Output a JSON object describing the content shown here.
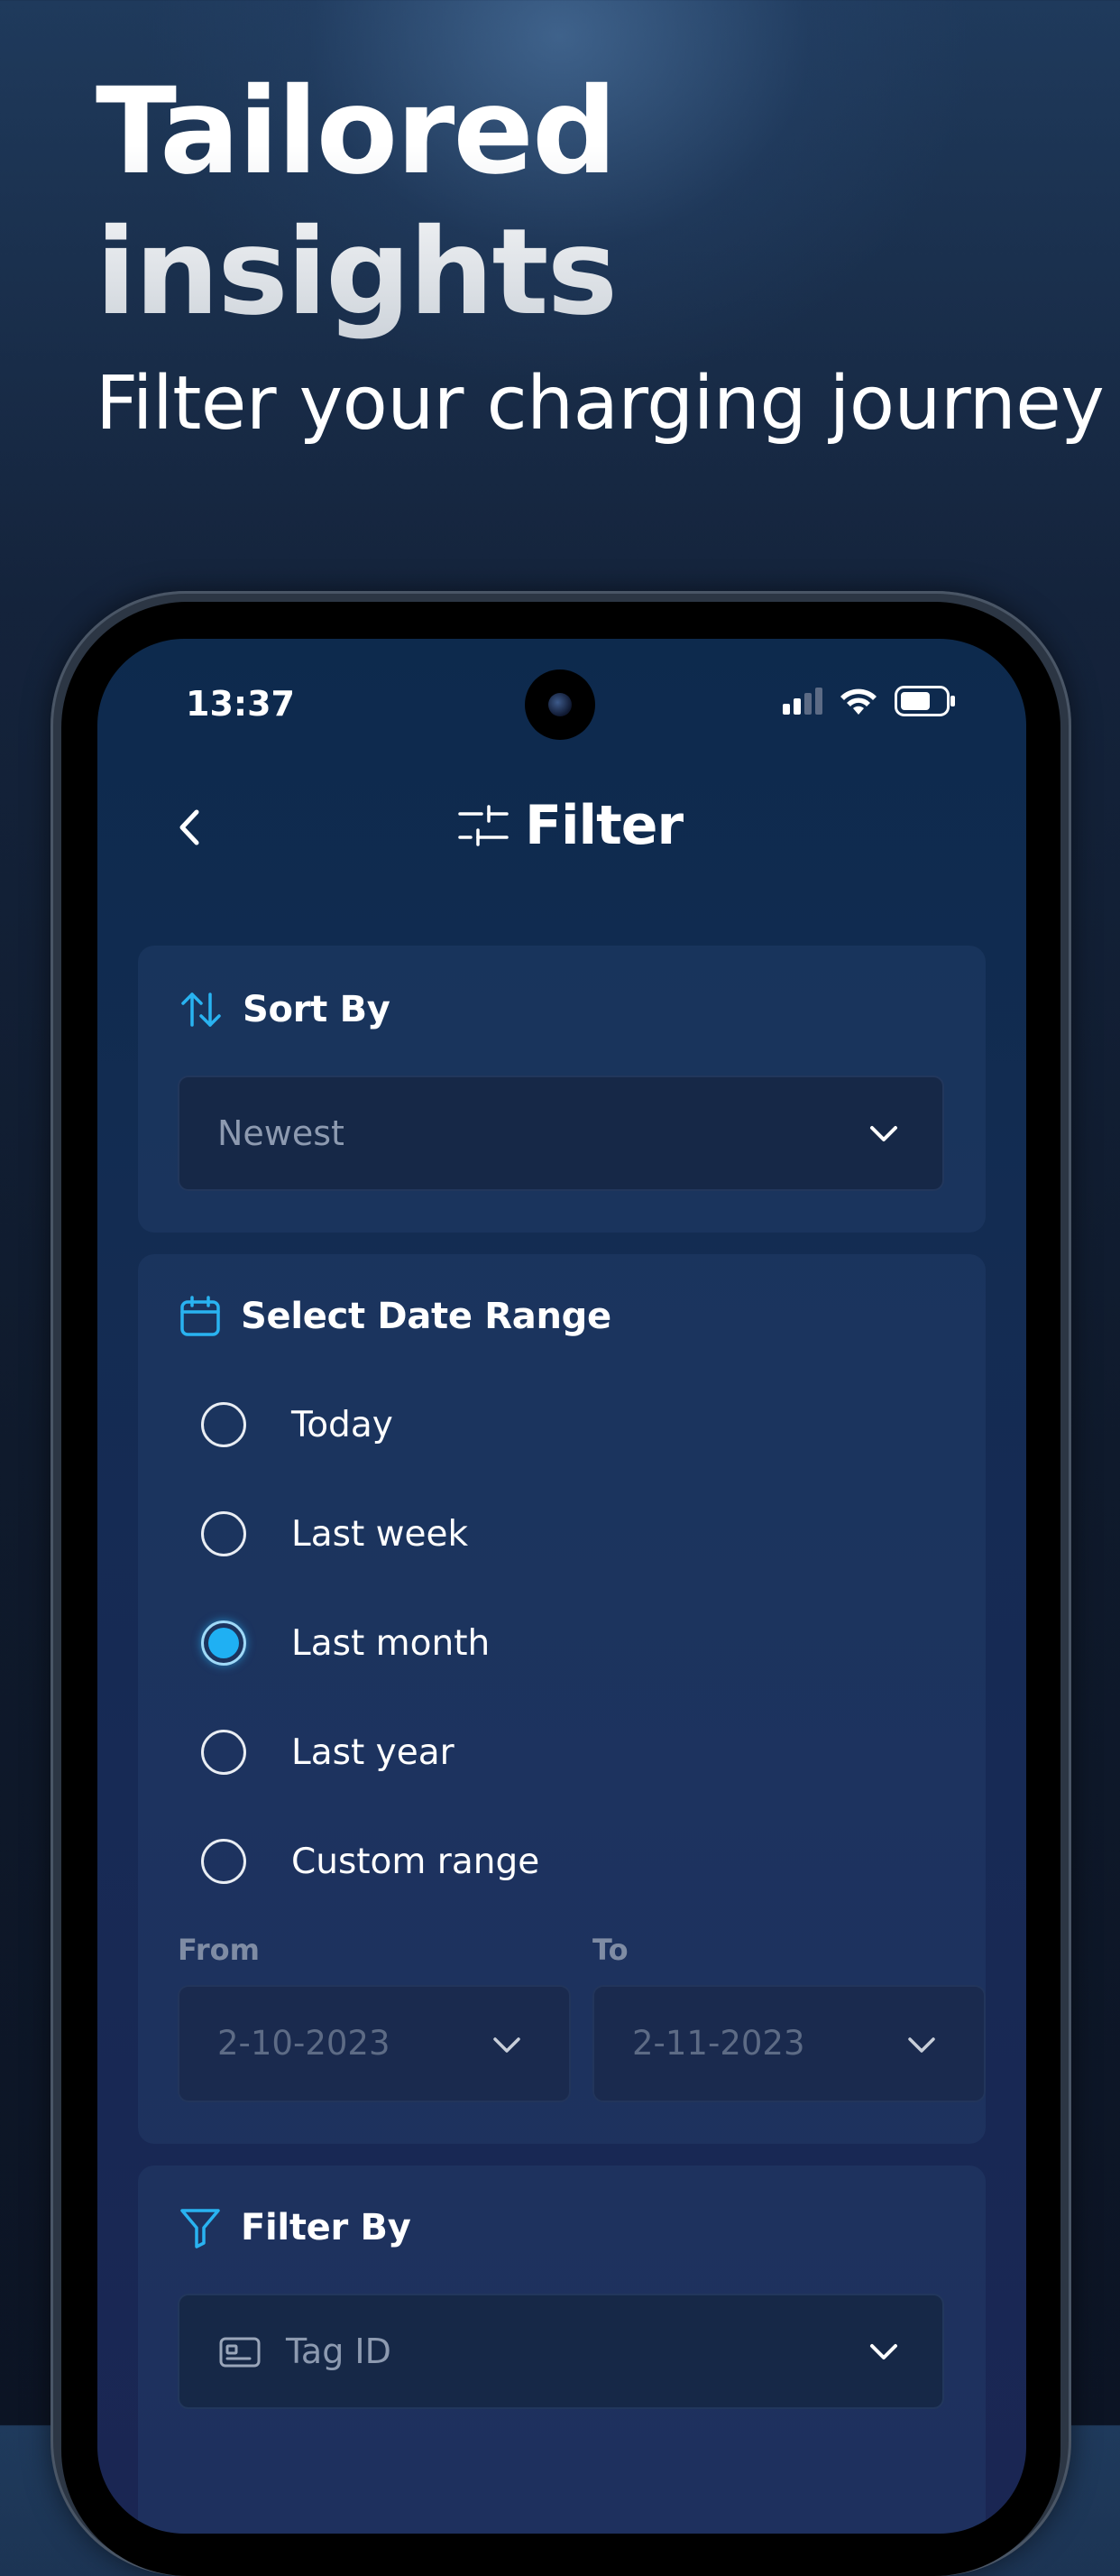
{
  "hero": {
    "title_line1": "Tailored",
    "title_line2": "insights",
    "subtitle": "Filter your charging journey"
  },
  "status_bar": {
    "time": "13:37"
  },
  "nav": {
    "back_icon": "chevron-left-icon",
    "title": "Filter",
    "title_icon": "sliders-icon"
  },
  "sort": {
    "heading": "Sort By",
    "icon": "sort-arrows-icon",
    "selected": "Newest"
  },
  "date_range": {
    "heading": "Select Date Range",
    "icon": "calendar-icon",
    "options": [
      {
        "label": "Today",
        "checked": false
      },
      {
        "label": "Last week",
        "checked": false
      },
      {
        "label": "Last month",
        "checked": true
      },
      {
        "label": "Last year",
        "checked": false
      },
      {
        "label": "Custom range",
        "checked": false
      }
    ],
    "from_label": "From",
    "from_value": "2-10-2023",
    "to_label": "To",
    "to_value": "2-11-2023"
  },
  "filter_by": {
    "heading": "Filter By",
    "icon": "funnel-icon",
    "field_icon": "id-card-icon",
    "selected": "Tag ID"
  },
  "colors": {
    "accent": "#1fb0f3",
    "card": "#1b3a63",
    "text_muted": "#8d9ab0"
  }
}
